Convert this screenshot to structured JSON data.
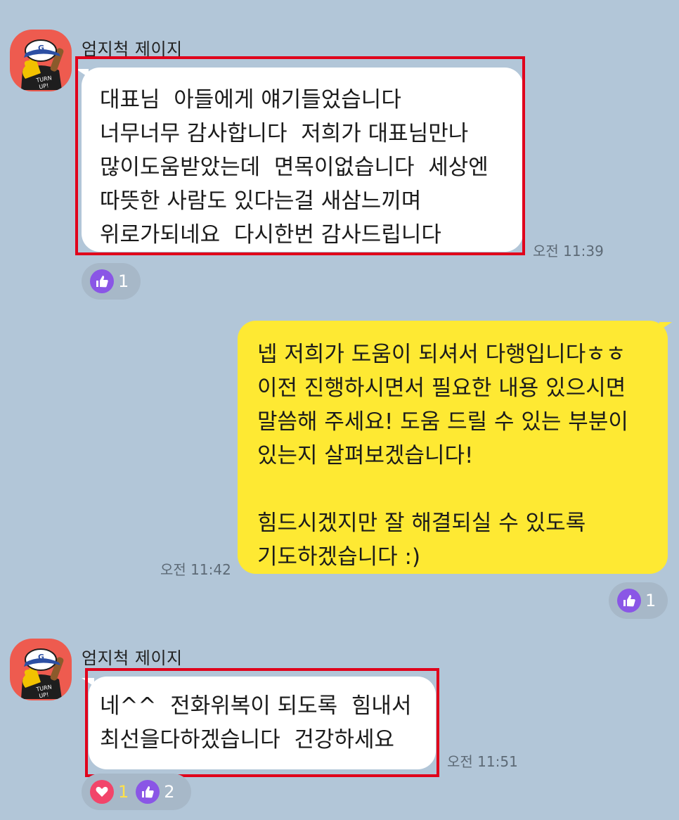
{
  "messages": [
    {
      "sender": "엄지척 제이지",
      "text": "대표님  아들에게 얘기들었습니다\n너무너무 감사합니다  저희가 대표님만나\n많이도움받았는데  면목이없습니다  세상엔\n따뜻한 사람도 있다는걸 새삼느끼며\n위로가되네요  다시한번 감사드립니다",
      "time": "오전 11:39",
      "reactions": [
        {
          "icon": "thumbs-up-icon",
          "count": "1"
        }
      ]
    },
    {
      "sender": "me",
      "text": "넵 저희가 도움이 되셔서 다행입니다ㅎㅎ\n이전 진행하시면서 필요한 내용 있으시면\n말씀해 주세요! 도움 드릴 수 있는 부분이\n있는지 살펴보겠습니다!\n\n힘드시겠지만 잘 해결되실 수 있도록\n기도하겠습니다 :)",
      "time": "오전 11:42",
      "reactions": [
        {
          "icon": "thumbs-up-icon",
          "count": "1"
        }
      ]
    },
    {
      "sender": "엄지척 제이지",
      "text": "네^^  전화위복이 되도록  힘내서\n최선을다하겠습니다  건강하세요",
      "time": "오전 11:51",
      "reactions": [
        {
          "icon": "heart-icon",
          "count": "1"
        },
        {
          "icon": "thumbs-up-icon",
          "count": "2"
        }
      ]
    }
  ],
  "colors": {
    "background": "#b2c6d8",
    "incoming_bubble": "#ffffff",
    "outgoing_bubble": "#fee933",
    "highlight": "#e0001b",
    "like": "#8a56e6",
    "heart": "#f2456a"
  },
  "avatar": {
    "icon": "profile-avatar-icon",
    "cap_letter": "G",
    "shirt_text": "TURN UP!"
  }
}
